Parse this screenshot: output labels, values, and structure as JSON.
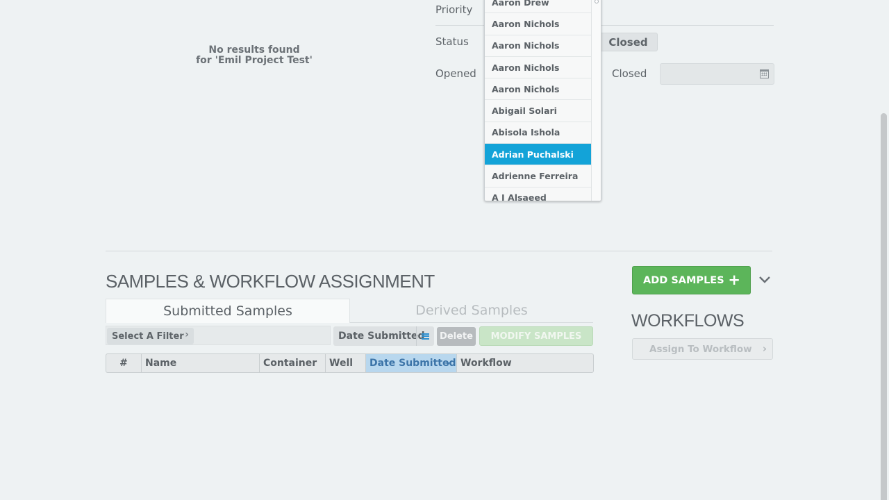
{
  "no_results": {
    "line1": "No results found",
    "line2": "for 'Emil Project Test'"
  },
  "fields": {
    "priority_label": "Priority",
    "status_label": "Status",
    "status_value": "Closed",
    "opened_label": "Opened",
    "closed_label": "Closed"
  },
  "dropdown": {
    "items": [
      "Aaron Drew",
      "Aaron Nichols",
      "Aaron Nichols",
      "Aaron Nichols",
      "Aaron Nichols",
      "Abigail Solari",
      "Abisola Ishola",
      "Adrian Puchalski",
      "Adrienne Ferreira",
      "A J Alsaeed"
    ],
    "selected": "Adrian Puchalski"
  },
  "samples": {
    "title": "SAMPLES & WORKFLOW ASSIGNMENT",
    "add_button": "ADD SAMPLES",
    "tabs": [
      "Submitted Samples",
      "Derived Samples"
    ],
    "filter_label": "Select A Filter",
    "sort_label": "Date Submitted",
    "delete_label": "Delete",
    "modify_label": "MODIFY SAMPLES",
    "columns": [
      "#",
      "Name",
      "Container",
      "Well",
      "Date Submitted",
      "Workflow"
    ]
  },
  "workflows": {
    "title": "WORKFLOWS",
    "assign_label": "Assign To Workflow"
  },
  "colors": {
    "accent_blue": "#13a3d8",
    "add_green": "#5cb55a"
  }
}
